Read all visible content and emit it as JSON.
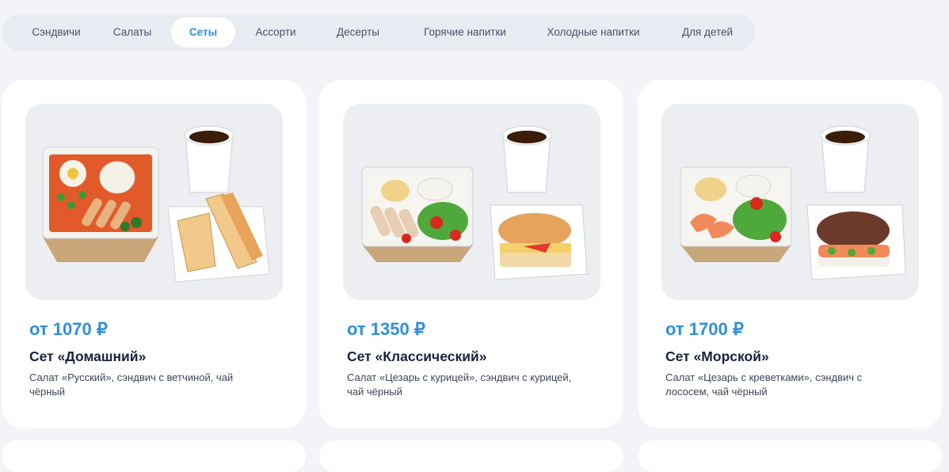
{
  "tabs": [
    "Сэндвичи",
    "Салаты",
    "Сеты",
    "Ассорти",
    "Десерты",
    "Горячие напитки",
    "Холодные напитки",
    "Для детей"
  ],
  "active_tab": "Сеты",
  "products": [
    {
      "price": "от 1070 ₽",
      "name": "Сет «Домашний»",
      "description": "Салат «Русский», сэндвич с ветчиной, чай чёрный"
    },
    {
      "price": "от 1350 ₽",
      "name": "Сет «Классический»",
      "description": "Салат «Цезарь с курицей», сэндвич с курицей, чай чёрный"
    },
    {
      "price": "от 1700 ₽",
      "name": "Сет «Морской»",
      "description": "Салат «Цезарь с креветками», сэндвич с лососем, чай чёрный"
    }
  ],
  "colors": {
    "accent": "#2f8fdc",
    "background": "#f2f4f8",
    "card": "#ffffff",
    "tab_bar": "#e8ecf2"
  }
}
